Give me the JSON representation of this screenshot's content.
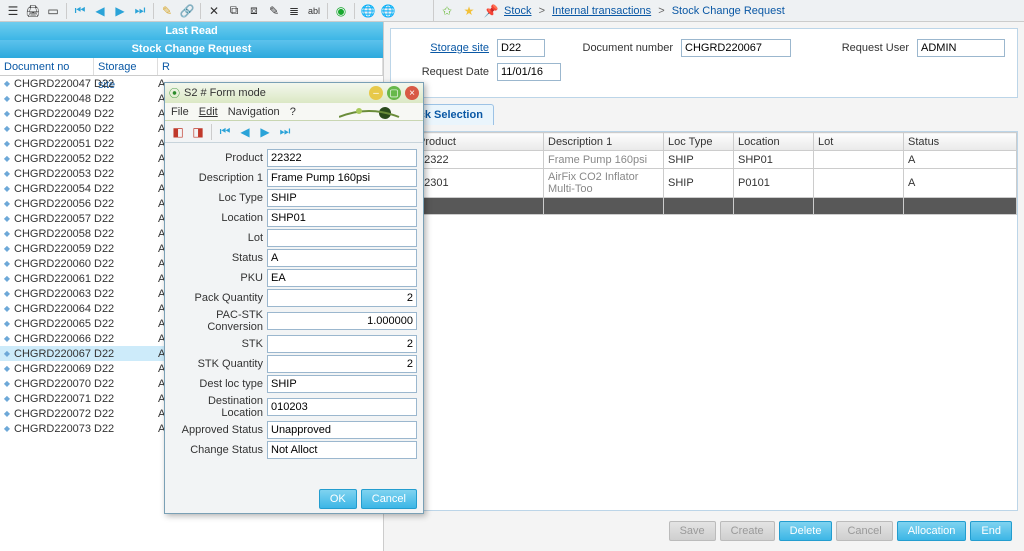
{
  "breadcrumb": {
    "stock": "Stock",
    "internal": "Internal transactions",
    "page": "Stock Change Request",
    "sep": ">"
  },
  "leftPane": {
    "lastRead": "Last Read",
    "title": "Stock Change Request",
    "headers": {
      "doc": "Document no",
      "site": "Storage site",
      "rest": "R"
    },
    "selected": "CHGRD220067",
    "rows": [
      {
        "doc": "CHGRD220047",
        "site": "D22",
        "r": "A"
      },
      {
        "doc": "CHGRD220048",
        "site": "D22",
        "r": "A"
      },
      {
        "doc": "CHGRD220049",
        "site": "D22",
        "r": "A"
      },
      {
        "doc": "CHGRD220050",
        "site": "D22",
        "r": "A"
      },
      {
        "doc": "CHGRD220051",
        "site": "D22",
        "r": "A"
      },
      {
        "doc": "CHGRD220052",
        "site": "D22",
        "r": "A"
      },
      {
        "doc": "CHGRD220053",
        "site": "D22",
        "r": "A"
      },
      {
        "doc": "CHGRD220054",
        "site": "D22",
        "r": "A"
      },
      {
        "doc": "CHGRD220056",
        "site": "D22",
        "r": "A"
      },
      {
        "doc": "CHGRD220057",
        "site": "D22",
        "r": "A"
      },
      {
        "doc": "CHGRD220058",
        "site": "D22",
        "r": "A"
      },
      {
        "doc": "CHGRD220059",
        "site": "D22",
        "r": "A"
      },
      {
        "doc": "CHGRD220060",
        "site": "D22",
        "r": "A"
      },
      {
        "doc": "CHGRD220061",
        "site": "D22",
        "r": "A"
      },
      {
        "doc": "CHGRD220063",
        "site": "D22",
        "r": "A"
      },
      {
        "doc": "CHGRD220064",
        "site": "D22",
        "r": "A"
      },
      {
        "doc": "CHGRD220065",
        "site": "D22",
        "r": "A"
      },
      {
        "doc": "CHGRD220066",
        "site": "D22",
        "r": "A"
      },
      {
        "doc": "CHGRD220067",
        "site": "D22",
        "r": "A"
      },
      {
        "doc": "CHGRD220069",
        "site": "D22",
        "r": "A"
      },
      {
        "doc": "CHGRD220070",
        "site": "D22",
        "r": "A"
      },
      {
        "doc": "CHGRD220071",
        "site": "D22",
        "r": "A"
      },
      {
        "doc": "CHGRD220072",
        "site": "D22",
        "r": "A"
      },
      {
        "doc": "CHGRD220073",
        "site": "D22",
        "r": "A"
      }
    ]
  },
  "header": {
    "storageSiteLabel": "Storage site",
    "storageSite": "D22",
    "docNumLabel": "Document number",
    "docNum": "CHGRD220067",
    "reqUserLabel": "Request User",
    "reqUser": "ADMIN",
    "reqDateLabel": "Request Date",
    "reqDate": "11/01/16"
  },
  "tab": {
    "stockSelection": "Stock Selection"
  },
  "grid": {
    "cols": {
      "product": "Product",
      "desc": "Description 1",
      "locType": "Loc Type",
      "location": "Location",
      "lot": "Lot",
      "status": "Status"
    },
    "rows": [
      {
        "n": "1",
        "product": "22322",
        "desc": "Frame Pump 160psi",
        "locType": "SHIP",
        "location": "SHP01",
        "lot": "",
        "status": "A"
      },
      {
        "n": "2",
        "product": "22301",
        "desc": "AirFix CO2 Inflator Multi-Too",
        "locType": "SHIP",
        "location": "P0101",
        "lot": "",
        "status": "A"
      },
      {
        "n": "3"
      }
    ]
  },
  "footer": {
    "save": "Save",
    "create": "Create",
    "delete": "Delete",
    "cancel": "Cancel",
    "allocation": "Allocation",
    "end": "End"
  },
  "modal": {
    "title": "S2 # Form mode",
    "menu": {
      "file": "File",
      "edit": "Edit",
      "nav": "Navigation",
      "help": "?"
    },
    "labels": {
      "product": "Product",
      "desc": "Description 1",
      "locType": "Loc Type",
      "location": "Location",
      "lot": "Lot",
      "status": "Status",
      "pku": "PKU",
      "packQty": "Pack Quantity",
      "pacStk": "PAC-STK Conversion",
      "stk": "STK",
      "stkQty": "STK Quantity",
      "destLocType": "Dest loc type",
      "destLoc": "Destination Location",
      "apprStatus": "Approved Status",
      "changeStatus": "Change Status"
    },
    "values": {
      "product": "22322",
      "desc": "Frame Pump 160psi",
      "locType": "SHIP",
      "location": "SHP01",
      "lot": "",
      "status": "A",
      "pku": "EA",
      "packQty": "2",
      "pacStk": "1.000000",
      "stk": "2",
      "stkQty": "2",
      "destLocType": "SHIP",
      "destLoc": "010203",
      "apprStatus": "Unapproved",
      "changeStatus": "Not Alloct"
    },
    "buttons": {
      "ok": "OK",
      "cancel": "Cancel"
    }
  }
}
